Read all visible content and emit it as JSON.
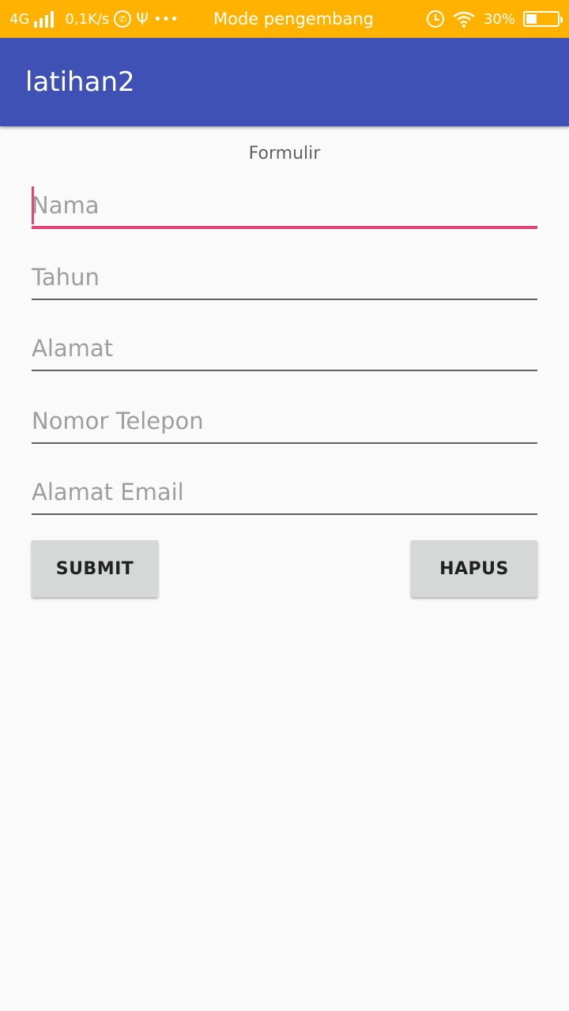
{
  "status_bar": {
    "network": "4G",
    "speed": "0,1K/s",
    "more_dots": "•••",
    "notification_text": "Mode pengembang",
    "battery_percent": "30%",
    "battery_level": 0.3,
    "icons": [
      "signal-icon",
      "whatsapp-icon",
      "usb-icon",
      "alarm-icon",
      "wifi-icon",
      "battery-icon"
    ]
  },
  "app_bar": {
    "title": "latihan2"
  },
  "form": {
    "heading": "Formulir",
    "fields": {
      "nama": {
        "placeholder": "Nama",
        "value": ""
      },
      "tahun": {
        "placeholder": "Tahun",
        "value": ""
      },
      "alamat": {
        "placeholder": "Alamat",
        "value": ""
      },
      "telepon": {
        "placeholder": "Nomor Telepon",
        "value": ""
      },
      "email": {
        "placeholder": "Alamat Email",
        "value": ""
      }
    },
    "buttons": {
      "submit": "SUBMIT",
      "hapus": "HAPUS"
    }
  },
  "colors": {
    "status_bar": "#ffb300",
    "app_bar": "#3f51b5",
    "accent": "#e0457b",
    "button": "#d6d7d7",
    "background": "#fafafa"
  }
}
